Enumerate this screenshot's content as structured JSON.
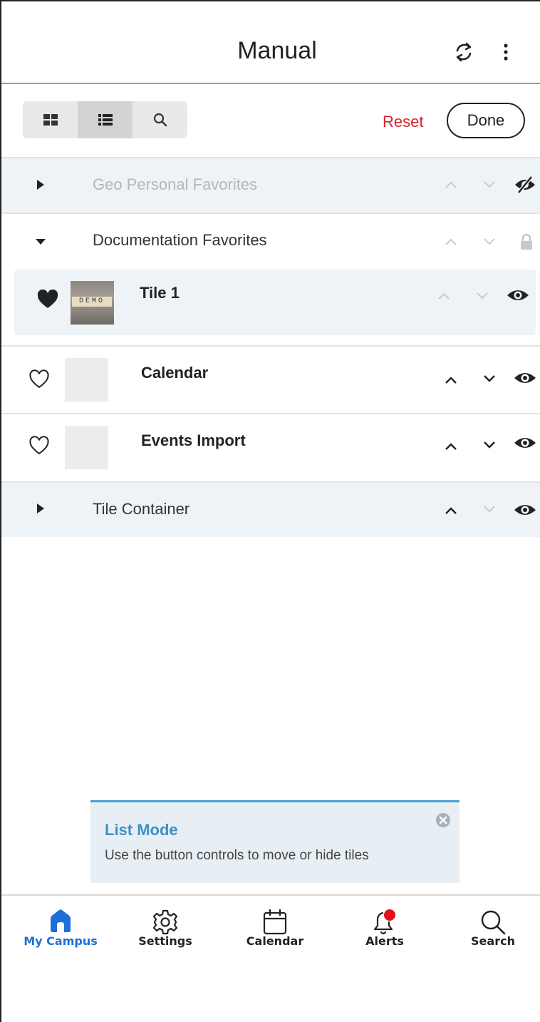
{
  "header": {
    "title": "Manual",
    "refresh_icon": "refresh-icon",
    "more_icon": "more-vertical-icon"
  },
  "toolbar": {
    "view_modes": [
      {
        "name": "grid",
        "icon": "grid-icon",
        "active": false
      },
      {
        "name": "list",
        "icon": "list-icon",
        "active": true
      },
      {
        "name": "search",
        "icon": "search-icon",
        "active": false
      }
    ],
    "reset_label": "Reset",
    "done_label": "Done",
    "reset_color": "#d6262e"
  },
  "rows": [
    {
      "type": "group",
      "label": "Geo Personal Favorites",
      "expanded": false,
      "muted": true,
      "visibility": "hidden"
    },
    {
      "type": "group",
      "label": "Documentation Favorites",
      "expanded": true,
      "muted": false,
      "visibility": "locked"
    },
    {
      "type": "tile",
      "label": "Tile 1",
      "favorite": true,
      "thumbnail_text": "DEMO",
      "visibility": "visible"
    },
    {
      "type": "tile",
      "label": "Calendar",
      "favorite": false,
      "visibility": "visible"
    },
    {
      "type": "tile",
      "label": "Events Import",
      "favorite": false,
      "visibility": "visible"
    },
    {
      "type": "group",
      "label": "Tile Container",
      "expanded": false,
      "muted": false,
      "visibility": "visible"
    }
  ],
  "toast": {
    "title": "List Mode",
    "message": "Use the button controls to move or hide tiles",
    "accent_color": "#4a9fd5"
  },
  "nav": {
    "items": [
      {
        "label": "My Campus",
        "icon": "home-icon",
        "active": true
      },
      {
        "label": "Settings",
        "icon": "gear-icon",
        "active": false
      },
      {
        "label": "Calendar",
        "icon": "calendar-icon",
        "active": false
      },
      {
        "label": "Alerts",
        "icon": "bell-icon",
        "active": false,
        "badge": true
      },
      {
        "label": "Search",
        "icon": "search-icon",
        "active": false
      }
    ],
    "active_color": "#1f6fd6",
    "badge_color": "#e3101b"
  }
}
